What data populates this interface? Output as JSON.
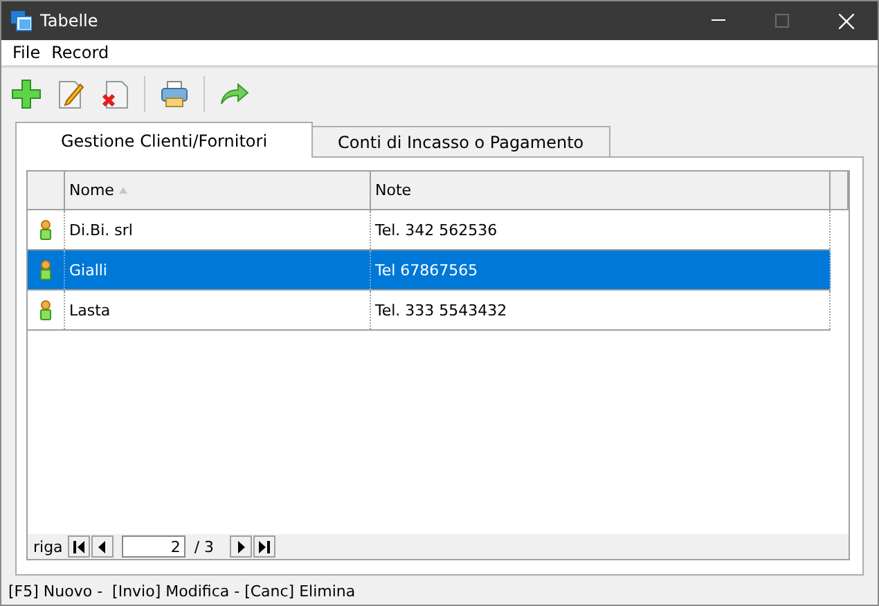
{
  "window": {
    "title": "Tabelle",
    "maximize_disabled": true
  },
  "menu": [
    "File",
    "Record"
  ],
  "tabs": [
    {
      "label": "Gestione Clienti/Fornitori",
      "selected": true
    },
    {
      "label": "Conti di Incasso o Pagamento",
      "selected": false
    }
  ],
  "table": {
    "columns": [
      {
        "label": "Nome",
        "sorted": true
      },
      {
        "label": "Note",
        "sorted": false
      }
    ],
    "rows": [
      {
        "cells": [
          "Di.Bi. srl",
          "Tel. 342 562536"
        ],
        "selected": false
      },
      {
        "cells": [
          "Gialli",
          "Tel 67867565"
        ],
        "selected": true
      },
      {
        "cells": [
          "Lasta",
          "Tel. 333 5543432"
        ],
        "selected": false
      }
    ]
  },
  "pager": {
    "label": "riga",
    "value": "2",
    "total": "/ 3"
  },
  "status_bar": "[F5] Nuovo -  [Invio] Modifica - [Canc] Elimina"
}
